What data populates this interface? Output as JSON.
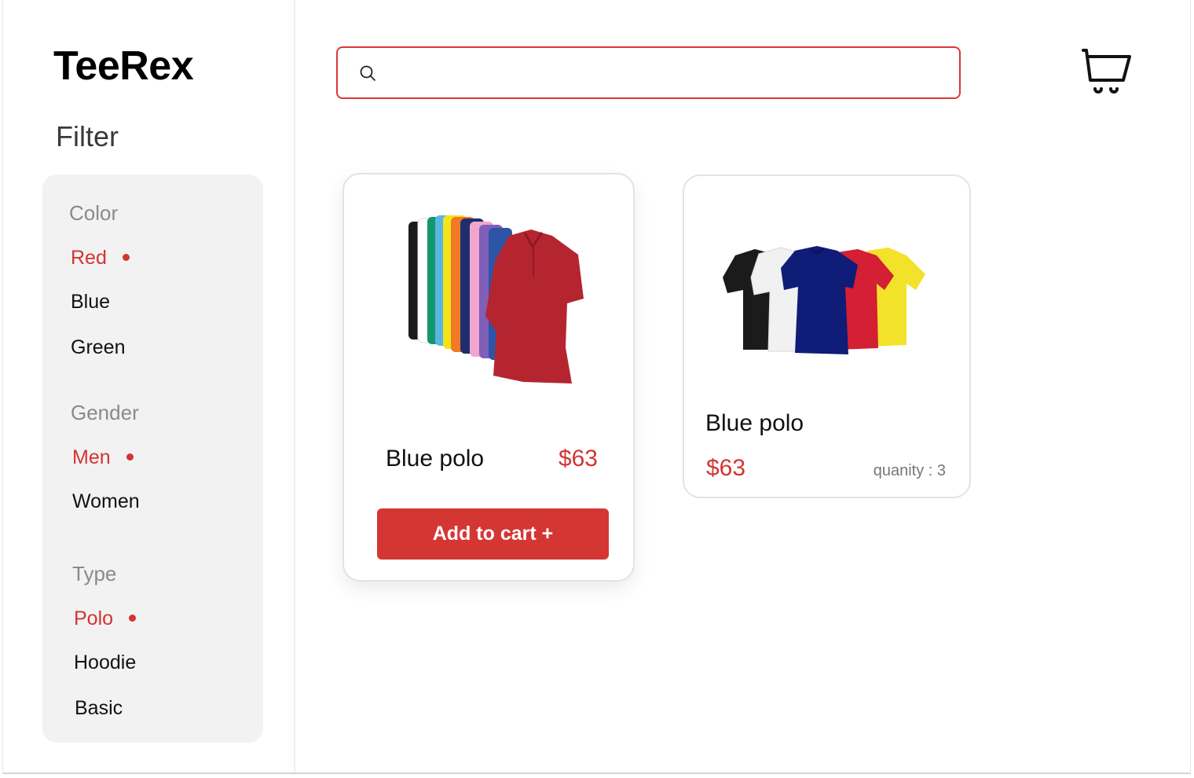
{
  "app": {
    "logo": "TeeRex",
    "filter_title": "Filter",
    "accent_color": "#d23532"
  },
  "filters": {
    "color": {
      "label": "Color",
      "options": [
        {
          "label": "Red",
          "selected": true
        },
        {
          "label": "Blue",
          "selected": false
        },
        {
          "label": "Green",
          "selected": false
        }
      ]
    },
    "gender": {
      "label": "Gender",
      "options": [
        {
          "label": "Men",
          "selected": true
        },
        {
          "label": "Women",
          "selected": false
        }
      ]
    },
    "type": {
      "label": "Type",
      "options": [
        {
          "label": "Polo",
          "selected": true
        },
        {
          "label": "Hoodie",
          "selected": false
        },
        {
          "label": "Basic",
          "selected": false
        }
      ]
    }
  },
  "search": {
    "value": "",
    "placeholder": "",
    "icon": "search-icon"
  },
  "header": {
    "cart_icon": "cart-icon"
  },
  "products": [
    {
      "name": "Blue polo",
      "price": "$63",
      "button_label": "Add to cart +",
      "image": "stacked-polo-shirts"
    },
    {
      "name": "Blue polo",
      "price": "$63",
      "quantity_label": "quanity : 3",
      "image": "stacked-tshirts"
    }
  ]
}
